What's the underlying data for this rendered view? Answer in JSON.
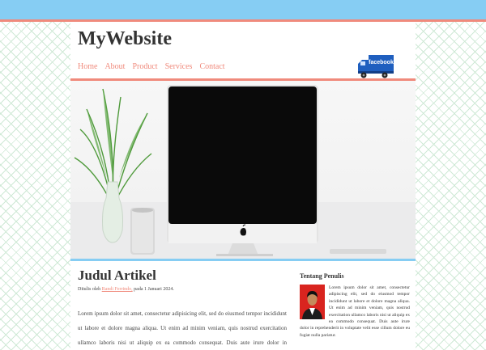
{
  "site": {
    "brand": "MyWebsite",
    "nav": [
      "Home",
      "About",
      "Product",
      "Services",
      "Contact"
    ],
    "facebook_label": "facebook"
  },
  "article": {
    "title": "Judul Artikel",
    "meta_prefix": "Ditulis oleh",
    "author": "Randi Ferrindo,",
    "meta_suffix": "pada 1 Januari 2024.",
    "body": "Lorem ipsum dolor sit amet, consectetur adipisicing elit, sed do eiusmod tempor incididunt ut labore et dolore magna aliqua. Ut enim ad minim veniam, quis nostrud exercitation ullamco laboris nisi ut aliquip ex ea commodo consequat. Duis aute irure dolor in reprehenderit in voluptate velit"
  },
  "sidebar": {
    "title": "Tentang Penulis",
    "text": "Lorem ipsum dolor sit amet, consectetur adipiscing elit, sed do eiusmod tempor incididunt ut labore et dolore magna aliqua. Ut enim ad minim veniam, quis nostrud exercitation ullamco laboris nisi ut aliquip ex ea commodo consequat. Duis aute irure dolor in reprehenderit in voluptate velit esse cillum dolore eu fugiat nulla pariatur."
  },
  "colors": {
    "top_bar": "#86cdf3",
    "accent": "#f08a7c"
  }
}
